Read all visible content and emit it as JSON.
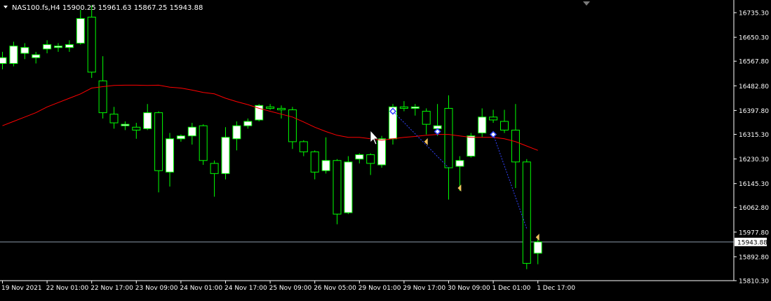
{
  "window": {
    "symbol_line": "NAS100.fs,H4  15900.25 15961.63 15867.25 15943.88",
    "current_price_label": "15943.88"
  },
  "colors": {
    "background": "#000000",
    "axis": "#ffffff",
    "bull_body": "#ffffff",
    "bear_body": "#000000",
    "wick": "#00ff00",
    "ma_line": "#ff0000",
    "price_line": "#8a9aaa",
    "trend_line": "#3344ff",
    "arrow": "#f0c060"
  },
  "chart_data": {
    "type": "candlestick",
    "symbol": "NAS100.fs",
    "timeframe": "H4",
    "ylim": [
      15810.3,
      16779
    ],
    "y_ticks": [
      "16735.30",
      "16650.30",
      "16567.80",
      "16482.80",
      "16397.80",
      "16315.30",
      "16230.30",
      "16145.30",
      "16062.80",
      "15977.80",
      "15892.80",
      "15810.30"
    ],
    "x_ticks": [
      {
        "label": "19 Nov 2021",
        "index": 0
      },
      {
        "label": "22 Nov 01:00",
        "index": 4
      },
      {
        "label": "22 Nov 17:00",
        "index": 8
      },
      {
        "label": "23 Nov 09:00",
        "index": 12
      },
      {
        "label": "24 Nov 01:00",
        "index": 16
      },
      {
        "label": "24 Nov 17:00",
        "index": 20
      },
      {
        "label": "25 Nov 09:00",
        "index": 24
      },
      {
        "label": "26 Nov 05:00",
        "index": 28
      },
      {
        "label": "29 Nov 01:00",
        "index": 32
      },
      {
        "label": "29 Nov 17:00",
        "index": 36
      },
      {
        "label": "30 Nov 09:00",
        "index": 40
      },
      {
        "label": "1 Dec 01:00",
        "index": 44
      },
      {
        "label": "1 Dec 17:00",
        "index": 48
      }
    ],
    "candles": [
      {
        "o": 16560,
        "h": 16600,
        "l": 16540,
        "c": 16580
      },
      {
        "o": 16560,
        "h": 16635,
        "l": 16550,
        "c": 16620
      },
      {
        "o": 16595,
        "h": 16630,
        "l": 16575,
        "c": 16615
      },
      {
        "o": 16580,
        "h": 16600,
        "l": 16560,
        "c": 16590
      },
      {
        "o": 16610,
        "h": 16640,
        "l": 16595,
        "c": 16625
      },
      {
        "o": 16615,
        "h": 16630,
        "l": 16600,
        "c": 16620
      },
      {
        "o": 16615,
        "h": 16640,
        "l": 16600,
        "c": 16625
      },
      {
        "o": 16630,
        "h": 16745,
        "l": 16625,
        "c": 16715
      },
      {
        "o": 16720,
        "h": 16760,
        "l": 16510,
        "c": 16530
      },
      {
        "o": 16500,
        "h": 16585,
        "l": 16370,
        "c": 16390
      },
      {
        "o": 16385,
        "h": 16410,
        "l": 16335,
        "c": 16355
      },
      {
        "o": 16345,
        "h": 16360,
        "l": 16330,
        "c": 16350
      },
      {
        "o": 16340,
        "h": 16355,
        "l": 16300,
        "c": 16330
      },
      {
        "o": 16335,
        "h": 16420,
        "l": 16330,
        "c": 16390
      },
      {
        "o": 16390,
        "h": 16395,
        "l": 16115,
        "c": 16190
      },
      {
        "o": 16185,
        "h": 16320,
        "l": 16135,
        "c": 16300
      },
      {
        "o": 16300,
        "h": 16315,
        "l": 16290,
        "c": 16310
      },
      {
        "o": 16310,
        "h": 16355,
        "l": 16280,
        "c": 16340
      },
      {
        "o": 16345,
        "h": 16350,
        "l": 16210,
        "c": 16225
      },
      {
        "o": 16215,
        "h": 16225,
        "l": 16100,
        "c": 16180
      },
      {
        "o": 16180,
        "h": 16340,
        "l": 16160,
        "c": 16305
      },
      {
        "o": 16300,
        "h": 16360,
        "l": 16260,
        "c": 16345
      },
      {
        "o": 16345,
        "h": 16370,
        "l": 16335,
        "c": 16360
      },
      {
        "o": 16365,
        "h": 16420,
        "l": 16360,
        "c": 16415
      },
      {
        "o": 16410,
        "h": 16420,
        "l": 16400,
        "c": 16405
      },
      {
        "o": 16405,
        "h": 16415,
        "l": 16370,
        "c": 16400
      },
      {
        "o": 16400,
        "h": 16410,
        "l": 16265,
        "c": 16290
      },
      {
        "o": 16290,
        "h": 16295,
        "l": 16240,
        "c": 16255
      },
      {
        "o": 16255,
        "h": 16260,
        "l": 16160,
        "c": 16185
      },
      {
        "o": 16190,
        "h": 16305,
        "l": 16180,
        "c": 16225
      },
      {
        "o": 16225,
        "h": 16230,
        "l": 16005,
        "c": 16040
      },
      {
        "o": 16045,
        "h": 16240,
        "l": 16040,
        "c": 16220
      },
      {
        "o": 16230,
        "h": 16250,
        "l": 16215,
        "c": 16245
      },
      {
        "o": 16245,
        "h": 16250,
        "l": 16175,
        "c": 16215
      },
      {
        "o": 16210,
        "h": 16310,
        "l": 16200,
        "c": 16300
      },
      {
        "o": 16300,
        "h": 16420,
        "l": 16280,
        "c": 16410
      },
      {
        "o": 16410,
        "h": 16430,
        "l": 16395,
        "c": 16405
      },
      {
        "o": 16405,
        "h": 16420,
        "l": 16380,
        "c": 16410
      },
      {
        "o": 16395,
        "h": 16405,
        "l": 16315,
        "c": 16350
      },
      {
        "o": 16335,
        "h": 16420,
        "l": 16310,
        "c": 16345
      },
      {
        "o": 16405,
        "h": 16450,
        "l": 16090,
        "c": 16200
      },
      {
        "o": 16205,
        "h": 16240,
        "l": 16120,
        "c": 16225
      },
      {
        "o": 16240,
        "h": 16320,
        "l": 16235,
        "c": 16310
      },
      {
        "o": 16320,
        "h": 16405,
        "l": 16305,
        "c": 16375
      },
      {
        "o": 16375,
        "h": 16400,
        "l": 16355,
        "c": 16365
      },
      {
        "o": 16360,
        "h": 16400,
        "l": 16320,
        "c": 16330
      },
      {
        "o": 16330,
        "h": 16420,
        "l": 16130,
        "c": 16220
      },
      {
        "o": 16220,
        "h": 16230,
        "l": 15850,
        "c": 15870
      },
      {
        "o": 15905,
        "h": 15965,
        "l": 15867,
        "c": 15944
      }
    ],
    "ma": [
      16345,
      16360,
      16375,
      16390,
      16410,
      16425,
      16440,
      16455,
      16475,
      16480,
      16484,
      16485,
      16485,
      16484,
      16485,
      16478,
      16475,
      16468,
      16460,
      16455,
      16440,
      16428,
      16418,
      16405,
      16395,
      16385,
      16375,
      16358,
      16340,
      16325,
      16312,
      16305,
      16305,
      16300,
      16295,
      16300,
      16305,
      16308,
      16312,
      16315,
      16315,
      16310,
      16305,
      16305,
      16305,
      16300,
      16290,
      16275,
      16260
    ],
    "trend_lines": [
      {
        "from": {
          "index": 35,
          "price": 16395
        },
        "to": {
          "index": 40,
          "price": 16200
        }
      },
      {
        "from": {
          "index": 44,
          "price": 16315
        },
        "to": {
          "index": 47,
          "price": 15990
        }
      }
    ],
    "diamond_markers": [
      {
        "index": 35,
        "price": 16395
      },
      {
        "index": 39,
        "price": 16325
      },
      {
        "index": 44,
        "price": 16315
      }
    ],
    "arrow_markers": [
      {
        "index": 38,
        "price": 16290
      },
      {
        "index": 41,
        "price": 16130
      },
      {
        "index": 48,
        "price": 15960
      }
    ],
    "current_price": 15943.88
  }
}
